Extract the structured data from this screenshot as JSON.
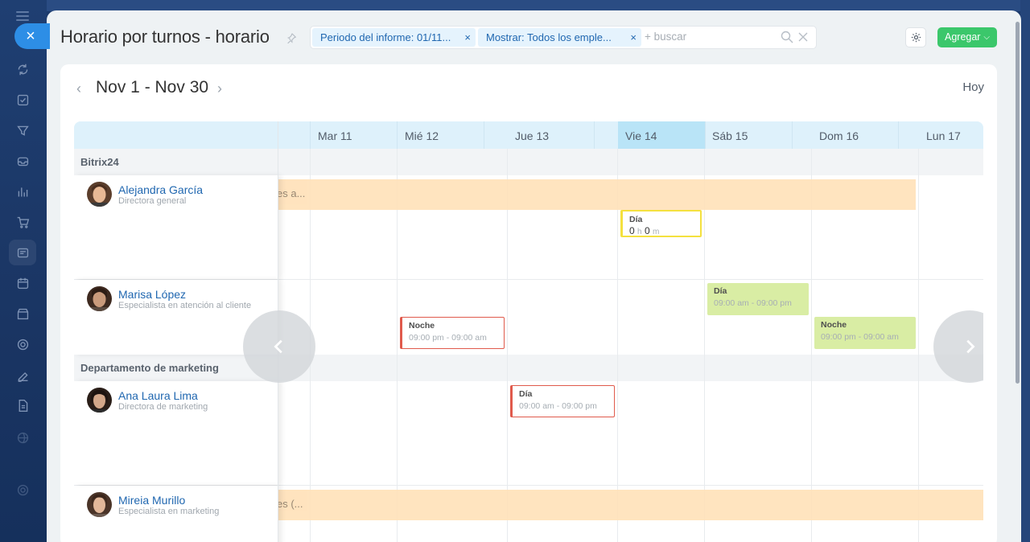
{
  "window": {
    "title": "Horario por turnos - horario",
    "close_label": "×"
  },
  "filter": {
    "chips": [
      {
        "label": "Periodo del informe: 01/11...",
        "remove": "×"
      },
      {
        "label": "Mostrar: Todos los emple...",
        "remove": "×"
      }
    ],
    "search_placeholder": "+ buscar"
  },
  "toolbar": {
    "add_label": "Agregar",
    "add_chevron": "⌵"
  },
  "calendar": {
    "range": "Nov 1 - Nov 30",
    "today_label": "Hoy",
    "prev": "‹",
    "next": "›",
    "days": [
      "Mar 11",
      "Mié 12",
      "Jue 13",
      "Vie 14",
      "Sáb 15",
      "Dom 16",
      "Lun 17"
    ],
    "highlight_day": "Vie 14"
  },
  "groups": [
    {
      "name": "Bitrix24",
      "employees": [
        {
          "name": "Alejandra García",
          "role": "Directora general"
        },
        {
          "name": "Marisa López",
          "role": "Especialista en atención al cliente"
        }
      ]
    },
    {
      "name": "Departamento de marketing",
      "employees": [
        {
          "name": "Ana Laura Lima",
          "role": "Directora de marketing"
        },
        {
          "name": "Mireia Murillo",
          "role": "Especialista en marketing"
        }
      ]
    }
  ],
  "absences": [
    {
      "text": "es a..."
    },
    {
      "text": "es (..."
    }
  ],
  "shifts": {
    "alejandra_vie": {
      "name": "Día",
      "hours": "0",
      "h_unit": "h",
      "minutes": "0",
      "m_unit": "m",
      "border": "#f4e13f"
    },
    "marisa_mie": {
      "name": "Noche",
      "time": "09:00 pm - 09:00 am",
      "border": "#e05a4c"
    },
    "marisa_sab": {
      "name": "Día",
      "time": "09:00 am - 09:00 pm",
      "bg": "#d9eda4"
    },
    "marisa_dom": {
      "name": "Noche",
      "time": "09:00 pm - 09:00 am",
      "bg": "#d9eda4"
    },
    "ana_jue": {
      "name": "Día",
      "time": "09:00 am - 09:00 pm",
      "border": "#e05a4c"
    }
  }
}
